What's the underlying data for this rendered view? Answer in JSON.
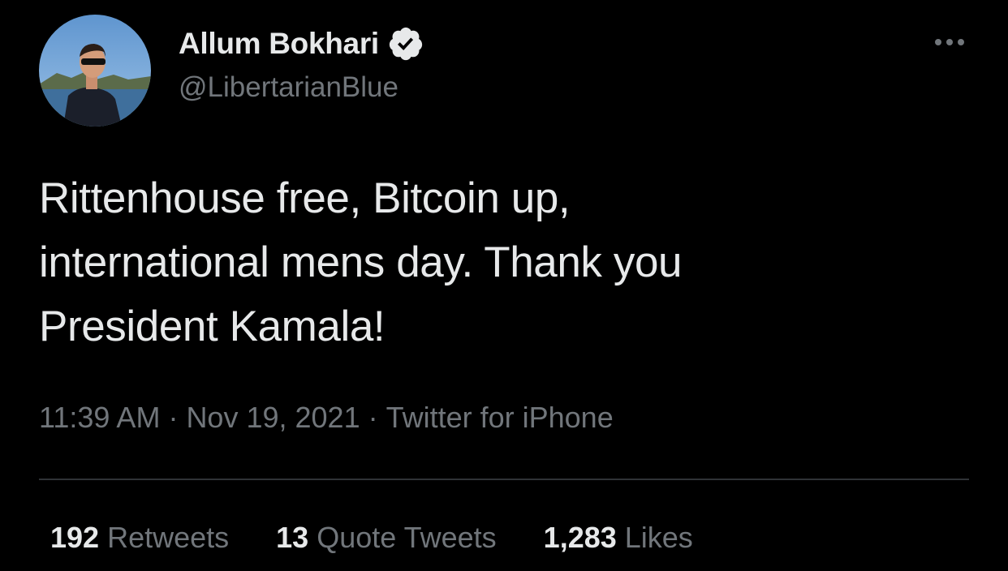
{
  "author": {
    "display_name": "Allum Bokhari",
    "handle": "@LibertarianBlue",
    "verified_icon": "verified-badge-icon"
  },
  "more_icon": "more-horizontal-icon",
  "tweet": {
    "text_lines": [
      "Rittenhouse free, Bitcoin up,",
      "international mens day. Thank you",
      "President Kamala!"
    ]
  },
  "meta": {
    "time": "11:39 AM",
    "date": "Nov 19, 2021",
    "source": "Twitter for iPhone",
    "separator": "·"
  },
  "stats": {
    "retweets": {
      "count": "192",
      "label": "Retweets"
    },
    "quotes": {
      "count": "13",
      "label": "Quote Tweets"
    },
    "likes": {
      "count": "1,283",
      "label": "Likes"
    }
  },
  "colors": {
    "background": "#000000",
    "primary_text": "#e7e9ea",
    "secondary_text": "#71767b",
    "divider": "#2f3336"
  }
}
